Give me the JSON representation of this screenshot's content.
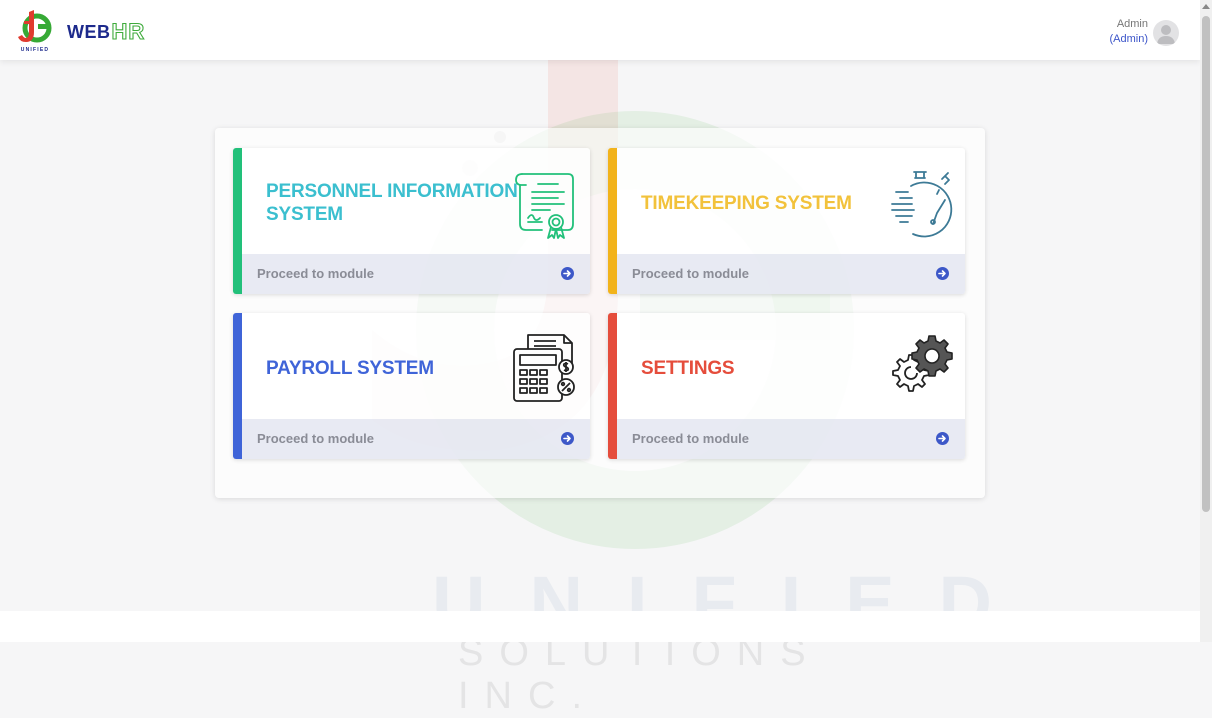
{
  "header": {
    "brand_web": "WEB",
    "brand_hr": "HR",
    "user_name": "Admin",
    "user_role": "(Admin)"
  },
  "watermark": {
    "line1": "UNIFIED",
    "line2": "SOLUTIONS INC."
  },
  "modules": [
    {
      "title_line1": "PERSONNEL INFORMATION",
      "title_line2": "SYSTEM",
      "footer": "Proceed to module",
      "icon": "certificate-icon",
      "color": "#3bbfcf",
      "accent": "#22c07a"
    },
    {
      "title_line1": "TIMEKEEPING SYSTEM",
      "footer": "Proceed to module",
      "icon": "stopwatch-icon",
      "color": "#f2c23b",
      "accent": "#f2b31b"
    },
    {
      "title_line1": "PAYROLL SYSTEM",
      "footer": "Proceed to module",
      "icon": "calculator-icon",
      "color": "#3f64d8",
      "accent": "#3f64d8"
    },
    {
      "title_line1": "SETTINGS",
      "footer": "Proceed to module",
      "icon": "gears-icon",
      "color": "#e54d3c",
      "accent": "#e54d3c"
    }
  ],
  "colors": {
    "brand_navy": "#1d2a8c",
    "brand_green": "#3daa3a",
    "link_blue": "#3c55c9",
    "arrow_blue": "#3d58c8"
  }
}
